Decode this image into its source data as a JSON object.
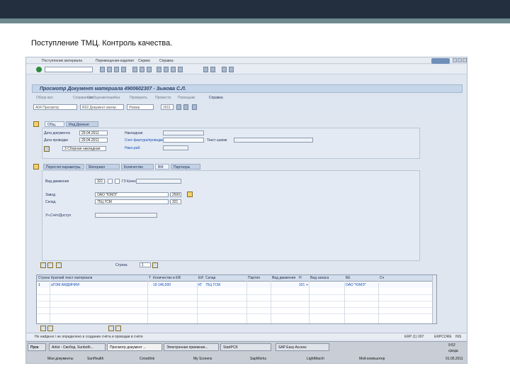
{
  "slide": {
    "title": "Поступление ТМЦ. Контроль качества."
  },
  "menu": {
    "items": [
      "Поступление материала",
      "Перемещения-изделия",
      "Сервис",
      "Справка"
    ]
  },
  "toolbar": {
    "command_placeholder": ""
  },
  "window": {
    "title": "Просмотр Документ материала 4900602307 - Зыкова С.Л."
  },
  "app_toolbar": {
    "items": [
      "Обзор вкл",
      "Сохранение",
      "Сообщение/ошибка",
      "Проверить",
      "Провести",
      "Помощник",
      "Справка"
    ]
  },
  "selectors": {
    "action": "A04 Просмотр",
    "doc_type": "R02 Документ матер",
    "num_label": "Номер",
    "year": "4900602307",
    "year2": "2011"
  },
  "header_tabs": [
    "Общ.",
    "Инд.Данные"
  ],
  "header": {
    "doc_date_label": "Дата документа",
    "doc_date": "29.04.2011",
    "post_date_label": "Дата проводки",
    "post_date": "29.04.2011",
    "invoice_label": "Накладная",
    "bill_label": "Счет-фактура/проводки",
    "receiver_label": "Накл.раб.",
    "text_label": "Текст шапки",
    "print_value": "3 Сборная накладная"
  },
  "item_tabs": [
    "Пересчет.параметры",
    "Материал",
    "Количество",
    "ВМ",
    "Партнеры"
  ],
  "item": {
    "movement_label": "Вид движения",
    "movement": "321",
    "movement_text": "ГЗ Качеств->своб.",
    "plant_label": "Завод",
    "plant": "ОАО \"ЮМЭ\"",
    "plant_code": "2500",
    "storage_label": "Склад",
    "storage": "75Ц ГСМ",
    "storage_code": "321",
    "account_label": "Уч.Счёт/Доступ"
  },
  "line_nav": {
    "label": "Строка",
    "value": "1"
  },
  "grid": {
    "headers": [
      "Строка",
      "Краткий текст материала",
      "Т",
      "Количество в ЕВ",
      "ЕИ",
      "Склад",
      "Партия",
      "Вид движения",
      "Н",
      "Вид запаса",
      "БЕ",
      "Сч"
    ],
    "row": {
      "pos": "1",
      "material": "аГОМ АМДИНИИ",
      "qty": "19 146,000",
      "uom": "КГ",
      "stor": "75Ц ГСМ",
      "mvt": "321",
      "flag": "+",
      "company": "ОАО \"ЮМЭ\""
    }
  },
  "status": {
    "message": "Не найдено / не определено и создание счёта и проводки в счёте",
    "system": "ERP (1) 007",
    "server": "ERPCORE",
    "mode": "INS"
  },
  "taskbar": {
    "start": "Пуск",
    "tasks": [
      "Artist - Свобод. Sunboth...",
      "Просмотр документ ...",
      "Электронная приемная...",
      "StartPCK",
      "SAP Easy Access"
    ],
    "quicklaunch": [
      "Мои документы",
      "SunHealth",
      "CrowdInk",
      "My Screens",
      "SapWorks",
      "LightMarch",
      "Мой компьютер"
    ],
    "clock": "9:52",
    "day": "среда",
    "date": "01.05.2011"
  }
}
